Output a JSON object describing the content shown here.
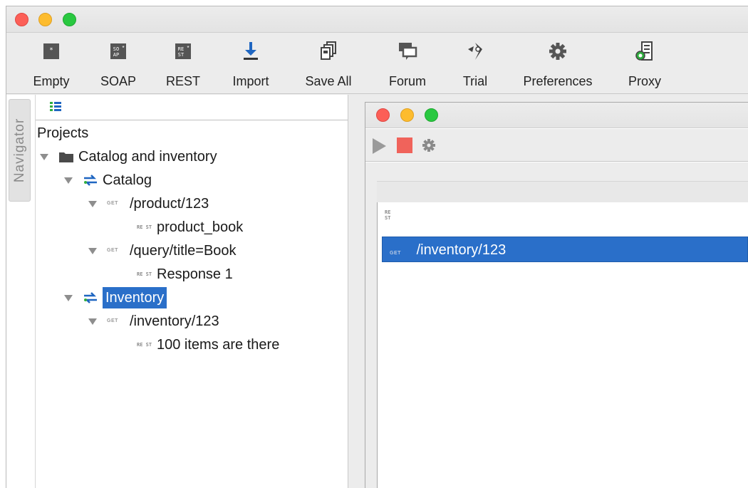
{
  "toolbar": {
    "items": [
      {
        "label": "Empty",
        "icon": "empty-project-icon"
      },
      {
        "label": "SOAP",
        "icon": "soap-project-icon"
      },
      {
        "label": "REST",
        "icon": "rest-project-icon"
      },
      {
        "label": "Import",
        "icon": "import-icon"
      },
      {
        "label": "Save All",
        "icon": "save-all-icon"
      },
      {
        "label": "Forum",
        "icon": "forum-icon"
      },
      {
        "label": "Trial",
        "icon": "trial-icon"
      },
      {
        "label": "Preferences",
        "icon": "gear-icon"
      },
      {
        "label": "Proxy",
        "icon": "proxy-icon"
      }
    ],
    "soap_glyph": "SO\nAP",
    "rest_glyph": "RE\nST"
  },
  "navigator": {
    "tab_label": "Navigator",
    "root_label": "Projects",
    "tree": {
      "project": "Catalog and inventory",
      "catalog": "Catalog",
      "get1": "/product/123",
      "resp1": "product_book",
      "get2": "/query/title=Book",
      "resp2": "Response 1",
      "inventory": "Inventory",
      "get3": "/inventory/123",
      "resp3": "100 items are there"
    },
    "method_tag": "GET",
    "rest_tag": "RE ST"
  },
  "editor": {
    "selected_request": "/inventory/123",
    "method_tag": "GET",
    "rest_tag": "RE ST"
  },
  "colors": {
    "selection": "#2a6fc9",
    "accent_blue": "#1f66c1",
    "stop_red": "#f0635b"
  }
}
